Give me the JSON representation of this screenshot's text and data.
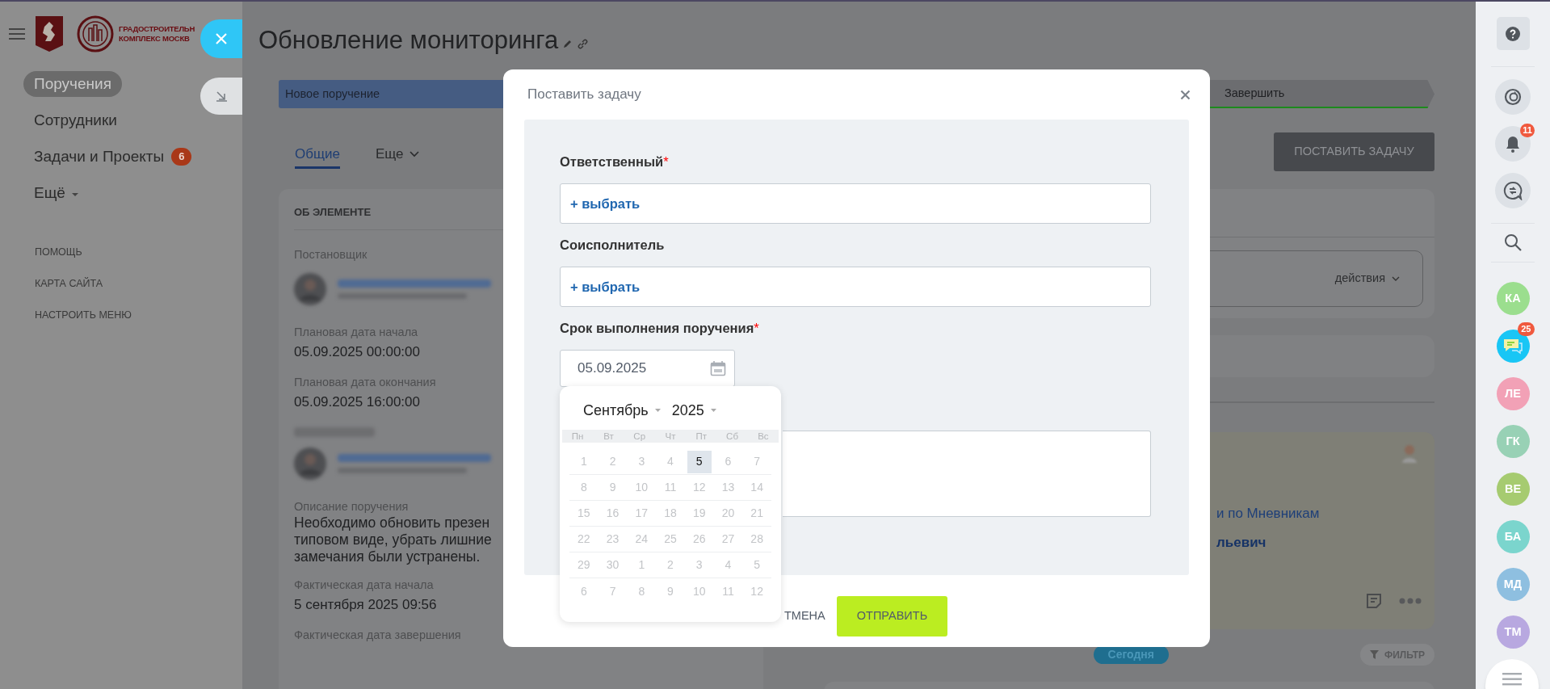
{
  "sidebar": {
    "logo_lines": [
      "ГРАДОСТРОИТЕЛЬН",
      "КОМПЛЕКС МОСКВ"
    ],
    "items": [
      {
        "label": "Поручения",
        "selected": true
      },
      {
        "label": "Сотрудники",
        "selected": false
      },
      {
        "label": "Задачи и Проекты",
        "selected": false,
        "badge": "6"
      },
      {
        "label": "Ещё",
        "selected": false,
        "dropdown": true
      }
    ],
    "links": [
      "ПОМОЩЬ",
      "КАРТА САЙТА",
      "НАСТРОИТЬ МЕНЮ"
    ]
  },
  "page": {
    "title": "Обновление мониторинга",
    "stages": [
      {
        "label": "Новое поручение",
        "kind": "current"
      },
      {
        "label": "Завершить",
        "kind": "final"
      }
    ],
    "tabs": [
      {
        "label": "Общие",
        "selected": true
      },
      {
        "label": "Еще",
        "selected": false
      }
    ],
    "action_button": "ПОСТАВИТЬ ЗАДАЧУ"
  },
  "details": {
    "heading": "ОБ ЭЛЕМЕНТЕ",
    "fields": [
      {
        "kind": "person",
        "label": "Постановщик"
      },
      {
        "kind": "value",
        "label": "Плановая дата начала",
        "value": "05.09.2025 00:00:00"
      },
      {
        "kind": "value",
        "label": "Плановая дата окончания",
        "value": "05.09.2025 16:00:00"
      },
      {
        "kind": "person"
      },
      {
        "kind": "lines",
        "label": "Описание поручения",
        "lines": [
          "Необходимо обновить презен",
          "типовом виде, убрать лишние",
          "замечания были устранены."
        ]
      },
      {
        "kind": "value",
        "label": "Фактическая дата начала",
        "value": "5 сентября 2025 09:56"
      },
      {
        "kind": "label",
        "label": "Фактическая дата завершения"
      }
    ]
  },
  "feed": {
    "actions": "действия",
    "card_lines": [
      "и по Мневникам",
      "льевич"
    ],
    "today": "Сегодня",
    "filter": "ФИЛЬТР"
  },
  "modal": {
    "title": "Поставить задачу",
    "fields": [
      {
        "kind": "picker",
        "label": "Ответственный",
        "required_mark": "*",
        "action": "+ выбрать"
      },
      {
        "kind": "picker",
        "label": "Соисполнитель",
        "action": "+ выбрать"
      },
      {
        "kind": "date",
        "label": "Срок выполнения поручения",
        "required_mark": "*",
        "value": "05.09.2025"
      }
    ],
    "buttons": [
      {
        "label": "ТМЕНА",
        "kind": "secondary"
      },
      {
        "label": "ОТПРАВИТЬ",
        "kind": "primary"
      }
    ]
  },
  "calendar": {
    "month": "Сентябрь",
    "year": "2025",
    "weekdays": [
      "Пн",
      "Вт",
      "Ср",
      "Чт",
      "Пт",
      "Сб",
      "Вс"
    ],
    "weeks": [
      [
        {
          "day": "1",
          "selected": false
        },
        {
          "day": "2",
          "selected": false
        },
        {
          "day": "3",
          "selected": false
        },
        {
          "day": "4",
          "selected": false
        },
        {
          "day": "5",
          "selected": true
        },
        {
          "day": "6",
          "selected": false
        },
        {
          "day": "7",
          "selected": false
        }
      ],
      [
        {
          "day": "8",
          "selected": false
        },
        {
          "day": "9",
          "selected": false
        },
        {
          "day": "10",
          "selected": false
        },
        {
          "day": "11",
          "selected": false
        },
        {
          "day": "12",
          "selected": false
        },
        {
          "day": "13",
          "selected": false
        },
        {
          "day": "14",
          "selected": false
        }
      ],
      [
        {
          "day": "15",
          "selected": false
        },
        {
          "day": "16",
          "selected": false
        },
        {
          "day": "17",
          "selected": false
        },
        {
          "day": "18",
          "selected": false
        },
        {
          "day": "19",
          "selected": false
        },
        {
          "day": "20",
          "selected": false
        },
        {
          "day": "21",
          "selected": false
        }
      ],
      [
        {
          "day": "22",
          "selected": false
        },
        {
          "day": "23",
          "selected": false
        },
        {
          "day": "24",
          "selected": false
        },
        {
          "day": "25",
          "selected": false
        },
        {
          "day": "26",
          "selected": false
        },
        {
          "day": "27",
          "selected": false
        },
        {
          "day": "28",
          "selected": false
        }
      ],
      [
        {
          "day": "29",
          "selected": false
        },
        {
          "day": "30",
          "selected": false
        },
        {
          "day": "1",
          "selected": false
        },
        {
          "day": "2",
          "selected": false
        },
        {
          "day": "3",
          "selected": false
        },
        {
          "day": "4",
          "selected": false
        },
        {
          "day": "5",
          "selected": false
        }
      ],
      [
        {
          "day": "6",
          "selected": false
        },
        {
          "day": "7",
          "selected": false
        },
        {
          "day": "8",
          "selected": false
        },
        {
          "day": "9",
          "selected": false
        },
        {
          "day": "10",
          "selected": false
        },
        {
          "day": "11",
          "selected": false
        },
        {
          "day": "12",
          "selected": false
        }
      ]
    ]
  },
  "right_bar": {
    "notifications_badge": "11",
    "chat_badge": "25",
    "contacts": [
      {
        "initials": "КА",
        "color": "#9bde8e"
      },
      {
        "kind": "chat"
      },
      {
        "initials": "ЛЕ",
        "color": "#f2a1b6"
      },
      {
        "initials": "ГК",
        "color": "#98d1b5"
      },
      {
        "initials": "ВЕ",
        "color": "#a6cb70"
      },
      {
        "initials": "БА",
        "color": "#7bd5cd"
      },
      {
        "initials": "МД",
        "color": "#8ebfe0"
      },
      {
        "initials": "ТМ",
        "color": "#b8a8e0"
      }
    ]
  }
}
